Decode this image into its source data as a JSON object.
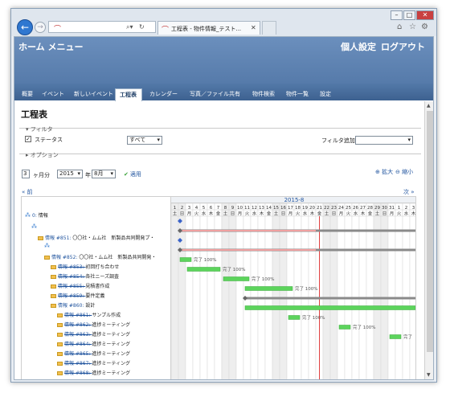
{
  "browser": {
    "tab_title": "工程表 - 物件情報_テスト...",
    "window_buttons": [
      "–",
      "□",
      "✕"
    ]
  },
  "header": {
    "home_menu": "ホーム メニュー",
    "personal_settings": "個人設定",
    "logout": "ログアウト"
  },
  "nav": {
    "items": [
      "概要",
      "イベント",
      "新しいイベント",
      "工程表",
      "カレンダー",
      "写真／ファイル共有",
      "物件検索",
      "物件一覧",
      "設定"
    ],
    "active_index": 3
  },
  "page": {
    "title": "工程表",
    "filter_legend": "フィルタ",
    "status_label": "ステータス",
    "status_checked": true,
    "status_value": "すべて",
    "add_filter_label": "フィルタ追加",
    "add_filter_value": "",
    "option_legend": "オプション"
  },
  "controls": {
    "months": "3",
    "months_suffix": "ヶ月分",
    "year": "2015",
    "year_suffix": "年",
    "month": "8月",
    "apply": "適用",
    "zoom_in": "拡大",
    "zoom_out": "縮小",
    "prev": "« 前",
    "next": "次 »"
  },
  "gantt": {
    "month_label": "2015-8",
    "days": [
      "1",
      "2",
      "3",
      "4",
      "5",
      "6",
      "7",
      "8",
      "9",
      "10",
      "11",
      "12",
      "13",
      "14",
      "15",
      "16",
      "17",
      "18",
      "19",
      "20",
      "21",
      "22",
      "23",
      "24",
      "25",
      "26",
      "27",
      "28",
      "29",
      "30",
      "31",
      "1",
      "2",
      "3"
    ],
    "weekdays": [
      "土",
      "日",
      "月",
      "火",
      "水",
      "木",
      "金",
      "土",
      "日",
      "月",
      "火",
      "水",
      "木",
      "金",
      "土",
      "日",
      "月",
      "火",
      "水",
      "木",
      "金",
      "土",
      "日",
      "月",
      "火",
      "水",
      "木",
      "金",
      "土",
      "日",
      "月",
      "火",
      "水",
      "木"
    ],
    "today_index": 20,
    "rows": [
      {
        "indent": 0,
        "icon": "group",
        "id": "0:",
        "text": "情報",
        "strike": false
      },
      {
        "indent": 1,
        "icon": "group",
        "id": "",
        "text": "",
        "strike": false
      },
      {
        "indent": 2,
        "icon": "folder",
        "id": "情報 #851:",
        "text": "〇〇社・ムム社　新製品共同開発プ・",
        "strike": false
      },
      {
        "indent": 3,
        "icon": "group",
        "id": "",
        "text": "",
        "strike": false
      },
      {
        "indent": 3,
        "icon": "folder",
        "id": "情報 #852:",
        "text": "〇〇社・ムム社　新製品共同開発・",
        "strike": false
      },
      {
        "indent": 4,
        "icon": "folder",
        "id": "情報 #853:",
        "text": "初回打ち合わせ",
        "strike": true
      },
      {
        "indent": 4,
        "icon": "folder",
        "id": "情報 #854:",
        "text": "各社ニーズ調査",
        "strike": true
      },
      {
        "indent": 4,
        "icon": "folder",
        "id": "情報 #855:",
        "text": "見積書作成",
        "strike": true
      },
      {
        "indent": 4,
        "icon": "folder",
        "id": "情報 #859:",
        "text": "要件定義",
        "strike": true
      },
      {
        "indent": 4,
        "icon": "folder",
        "id": "情報 #860:",
        "text": "設計",
        "strike": false
      },
      {
        "indent": 5,
        "icon": "folder",
        "id": "情報 #861:",
        "text": "サンプル作成",
        "strike": true
      },
      {
        "indent": 5,
        "icon": "folder",
        "id": "情報 #862:",
        "text": "進捗ミーティング",
        "strike": true
      },
      {
        "indent": 5,
        "icon": "folder",
        "id": "情報 #863:",
        "text": "進捗ミーティング",
        "strike": true
      },
      {
        "indent": 5,
        "icon": "folder",
        "id": "情報 #864:",
        "text": "進捗ミーティング",
        "strike": true
      },
      {
        "indent": 5,
        "icon": "folder",
        "id": "情報 #865:",
        "text": "進捗ミーティング",
        "strike": true
      },
      {
        "indent": 5,
        "icon": "folder",
        "id": "情報 #867:",
        "text": "進捗ミーティング",
        "strike": true
      },
      {
        "indent": 5,
        "icon": "folder",
        "id": "情報 #868:",
        "text": "進捗ミーティング",
        "strike": true
      }
    ],
    "bars": [
      {
        "row": 1,
        "type": "milestone",
        "start": 1
      },
      {
        "row": 2,
        "type": "parent",
        "start": 1,
        "end": 33,
        "done_end": 19
      },
      {
        "row": 3,
        "type": "milestone",
        "start": 1
      },
      {
        "row": 4,
        "type": "parent",
        "start": 1,
        "end": 33,
        "done_end": 19
      },
      {
        "row": 5,
        "type": "task",
        "start": 1,
        "end": 2,
        "label": "完了 100%"
      },
      {
        "row": 6,
        "type": "task",
        "start": 2,
        "end": 6,
        "label": "完了 100%"
      },
      {
        "row": 7,
        "type": "task",
        "start": 7,
        "end": 10,
        "label": "完了 100%"
      },
      {
        "row": 8,
        "type": "task",
        "start": 10,
        "end": 16,
        "label": "完了 100%"
      },
      {
        "row": 9,
        "type": "parent",
        "start": 10,
        "end": 33,
        "done_end": 33
      },
      {
        "row": 10,
        "type": "task",
        "start": 10,
        "end": 33,
        "label": ""
      },
      {
        "row": 11,
        "type": "task",
        "start": 16,
        "end": 17,
        "label": "完了 100%"
      },
      {
        "row": 12,
        "type": "task",
        "start": 23,
        "end": 24,
        "label": "完了 100%"
      },
      {
        "row": 13,
        "type": "task",
        "start": 30,
        "end": 31,
        "label": "完了"
      }
    ]
  }
}
